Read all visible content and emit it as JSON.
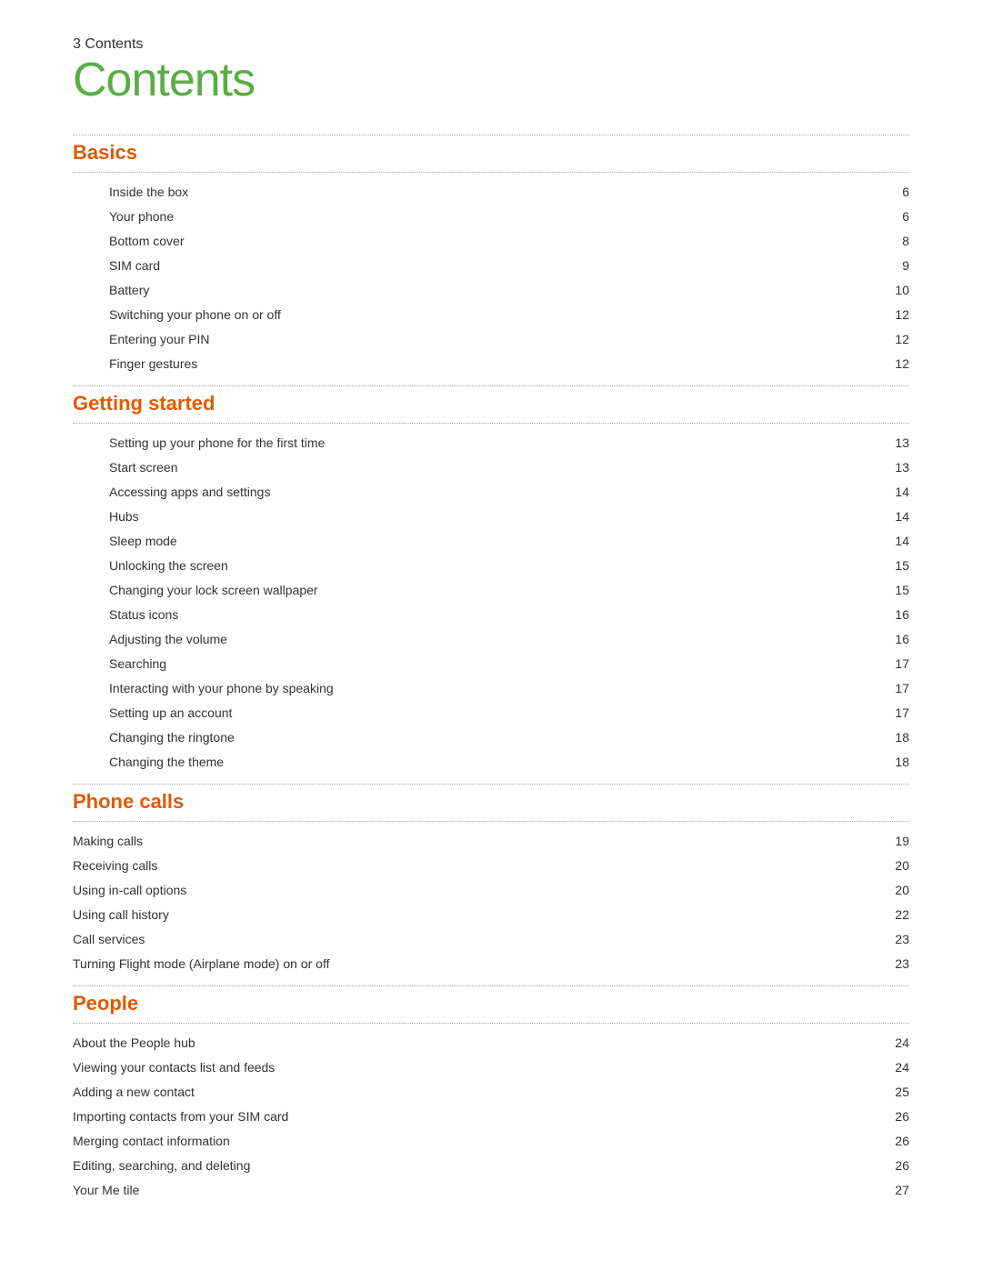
{
  "page": {
    "number": "3",
    "number_label": "3    Contents",
    "title": "Contents"
  },
  "sections": [
    {
      "id": "basics",
      "heading": "Basics",
      "indented": true,
      "items": [
        {
          "label": "Inside the box",
          "page": "6"
        },
        {
          "label": "Your phone",
          "page": "6"
        },
        {
          "label": "Bottom cover",
          "page": "8"
        },
        {
          "label": "SIM card",
          "page": "9"
        },
        {
          "label": "Battery",
          "page": "10"
        },
        {
          "label": "Switching your phone on or off",
          "page": "12"
        },
        {
          "label": "Entering your PIN",
          "page": "12"
        },
        {
          "label": "Finger gestures",
          "page": "12"
        }
      ]
    },
    {
      "id": "getting-started",
      "heading": "Getting started",
      "indented": true,
      "items": [
        {
          "label": "Setting up your phone for the first time",
          "page": "13"
        },
        {
          "label": "Start screen",
          "page": "13"
        },
        {
          "label": "Accessing apps and settings",
          "page": "14"
        },
        {
          "label": "Hubs",
          "page": "14"
        },
        {
          "label": "Sleep mode",
          "page": "14"
        },
        {
          "label": "Unlocking the screen",
          "page": "15"
        },
        {
          "label": "Changing your lock screen wallpaper",
          "page": "15"
        },
        {
          "label": "Status icons",
          "page": "16"
        },
        {
          "label": "Adjusting the volume",
          "page": "16"
        },
        {
          "label": "Searching",
          "page": "17"
        },
        {
          "label": "Interacting with your phone by speaking",
          "page": "17"
        },
        {
          "label": "Setting up an account",
          "page": "17"
        },
        {
          "label": "Changing the ringtone",
          "page": "18"
        },
        {
          "label": "Changing the theme",
          "page": "18"
        }
      ]
    },
    {
      "id": "phone-calls",
      "heading": "Phone calls",
      "indented": false,
      "items": [
        {
          "label": "Making calls",
          "page": "19"
        },
        {
          "label": "Receiving calls",
          "page": "20"
        },
        {
          "label": "Using in-call options",
          "page": "20"
        },
        {
          "label": "Using call history",
          "page": "22"
        },
        {
          "label": "Call services",
          "page": "23"
        },
        {
          "label": "Turning Flight mode (Airplane mode) on or off",
          "page": "23"
        }
      ]
    },
    {
      "id": "people",
      "heading": "People",
      "indented": false,
      "items": [
        {
          "label": "About the People hub",
          "page": "24"
        },
        {
          "label": "Viewing your contacts list and feeds",
          "page": "24"
        },
        {
          "label": "Adding a new contact",
          "page": "25"
        },
        {
          "label": "Importing contacts from your SIM card",
          "page": "26"
        },
        {
          "label": "Merging contact information",
          "page": "26"
        },
        {
          "label": "Editing, searching, and deleting",
          "page": "26"
        },
        {
          "label": "Your Me tile",
          "page": "27"
        }
      ]
    }
  ]
}
